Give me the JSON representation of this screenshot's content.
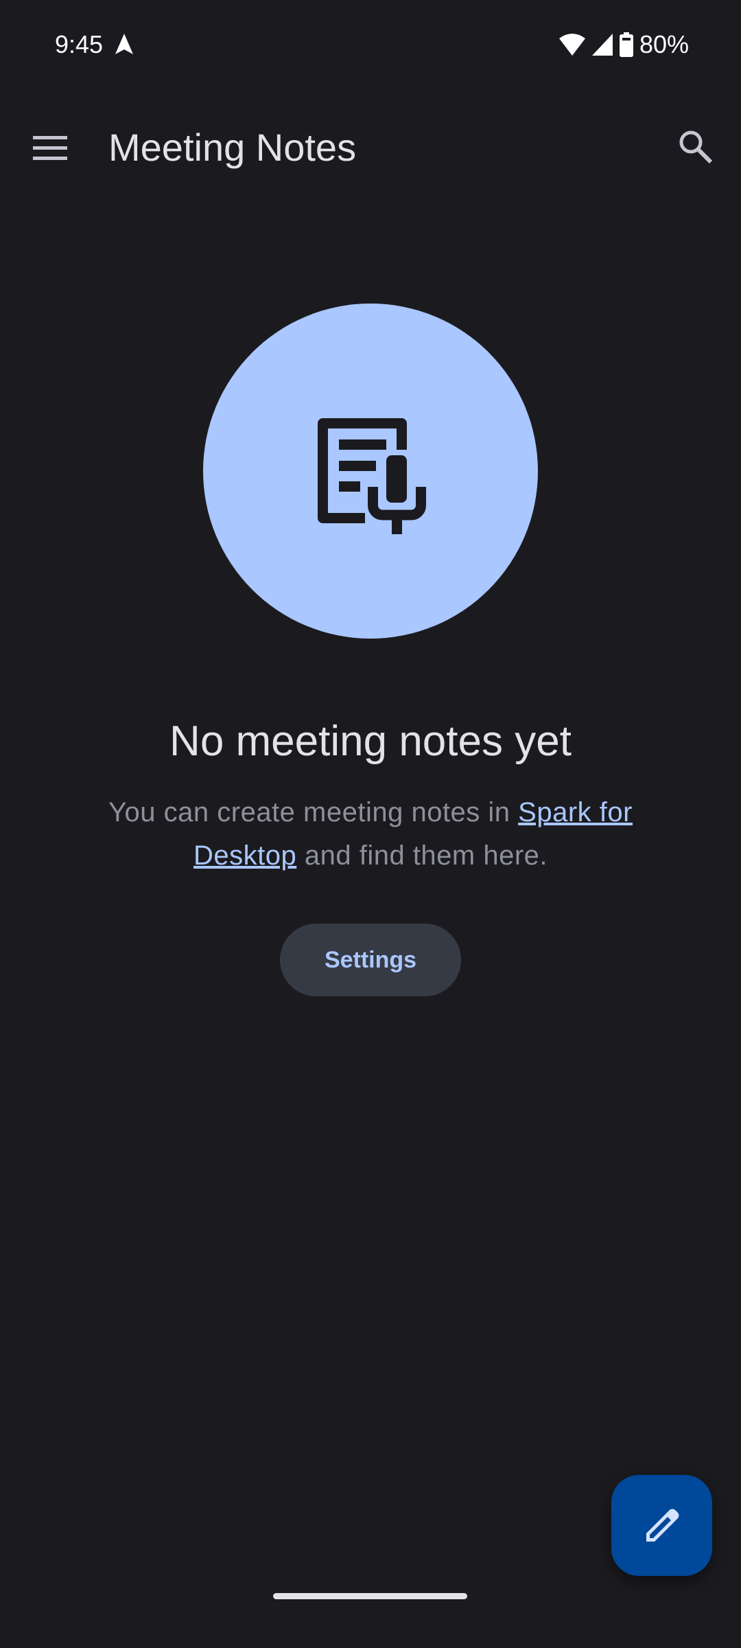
{
  "status_bar": {
    "time": "9:45",
    "battery": "80%",
    "icons": [
      "navigation-arrow-icon",
      "wifi-icon",
      "cellular-signal-icon",
      "battery-icon"
    ]
  },
  "app_bar": {
    "title": "Meeting Notes",
    "menu_icon": "hamburger-menu-icon",
    "search_icon": "search-icon"
  },
  "empty_state": {
    "icon": "meeting-notes-mic-icon",
    "heading": "No meeting notes yet",
    "body_prefix": "You can create meeting notes in ",
    "link_text": "Spark for Desktop",
    "body_suffix": " and find them here.",
    "button_label": "Settings"
  },
  "fab": {
    "icon": "pencil-icon"
  },
  "colors": {
    "background": "#1b1b1f",
    "accent": "#aac7ff",
    "fab": "#00489a",
    "button": "#363a45"
  }
}
